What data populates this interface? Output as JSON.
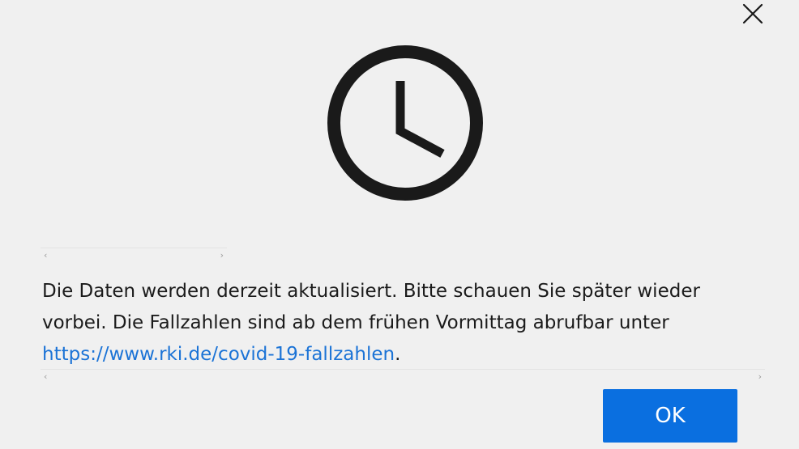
{
  "dialog": {
    "icons": {
      "close": "close-icon",
      "clock": "clock-icon"
    },
    "message": {
      "text_before": "Die Daten werden derzeit aktualisiert. Bitte schauen Sie später wieder vorbei. Die Fallzahlen sind ab dem frühen Vormittag abrufbar unter ",
      "link_text": "https://www.rki.de/covid-19-fallzahlen",
      "text_after": "."
    },
    "scroll_arrows": {
      "left": "‹",
      "right": "›"
    },
    "ok_label": "OK"
  },
  "colors": {
    "background": "#f0f0f0",
    "text": "#1b1b1b",
    "link": "#1b73d6",
    "button": "#0a6fe0",
    "button_text": "#ffffff",
    "icon": "#1a1a1a"
  }
}
